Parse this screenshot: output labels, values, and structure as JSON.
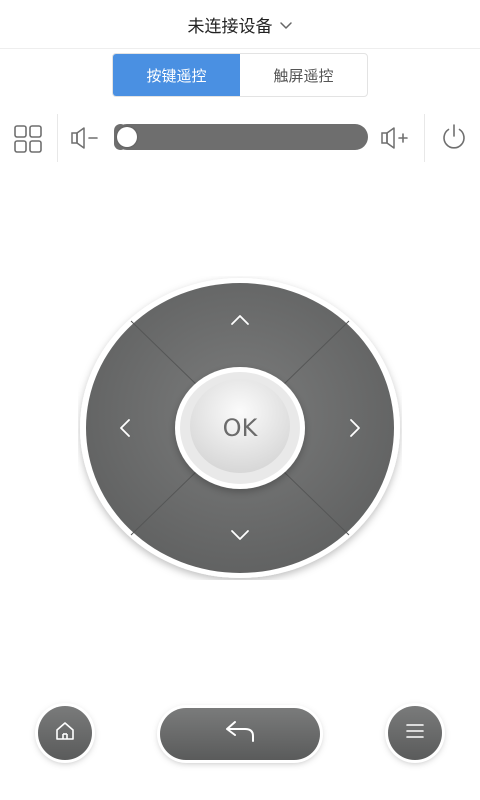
{
  "header": {
    "title": "未连接设备",
    "dropdown_icon": "chevron-down-icon"
  },
  "tabs": [
    {
      "label": "按键遥控",
      "active": true
    },
    {
      "label": "触屏遥控",
      "active": false
    }
  ],
  "controls": {
    "apps_icon": "grid-icon",
    "volume_down_icon": "volume-down-icon",
    "volume_up_icon": "volume-up-icon",
    "power_icon": "power-icon",
    "volume_level": 0.0
  },
  "dpad": {
    "ok_label": "OK",
    "up_icon": "chevron-up-icon",
    "down_icon": "chevron-down-icon",
    "left_icon": "chevron-left-icon",
    "right_icon": "chevron-right-icon"
  },
  "bottom": {
    "home_icon": "home-icon",
    "back_icon": "back-arrow-icon",
    "menu_icon": "menu-icon"
  },
  "colors": {
    "accent": "#4a90e2",
    "pad_gray": "#6b6c6c",
    "slider_track": "#6e6e6e"
  }
}
